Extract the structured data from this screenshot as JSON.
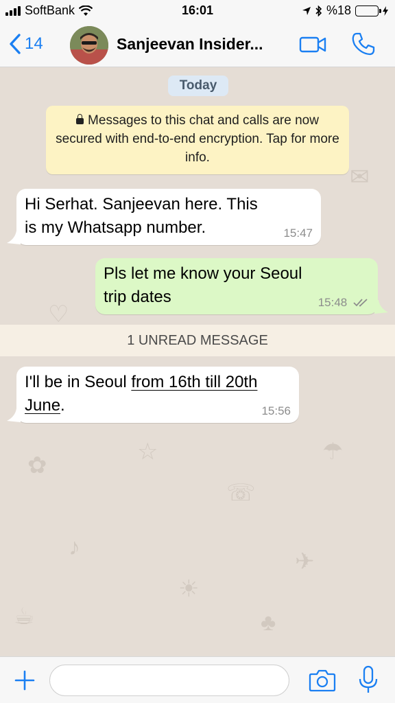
{
  "status_bar": {
    "carrier": "SoftBank",
    "time": "16:01",
    "battery_label": "%18",
    "battery_level": 0.18
  },
  "header": {
    "back_count": "14",
    "contact_name": "Sanjeevan Insider...",
    "icons": [
      "chevron-left-icon",
      "video-call-icon",
      "phone-icon"
    ]
  },
  "chat": {
    "date_label": "Today",
    "encryption_notice": "Messages to this chat and calls are now secured with end-to-end encryption. Tap for more info.",
    "messages": [
      {
        "direction": "incoming",
        "text": "Hi Serhat. Sanjeevan here. This is my Whatsapp number.",
        "time": "15:47"
      },
      {
        "direction": "outgoing",
        "text": "Pls let me know your Seoul trip dates",
        "time": "15:48",
        "status": "delivered"
      },
      {
        "direction": "incoming",
        "text_before": "I'll be in Seoul ",
        "text_link": "from 16th till 20th June",
        "text_after": ".",
        "time": "15:56"
      }
    ],
    "unread_label": "1 UNREAD MESSAGE"
  },
  "input_bar": {
    "placeholder": "",
    "icons": [
      "plus-icon",
      "camera-icon",
      "microphone-icon"
    ]
  },
  "colors": {
    "accent": "#1a7ff2",
    "outgoing_bubble": "#dcf8c6",
    "incoming_bubble": "#ffffff",
    "chat_background": "#e5ddd5",
    "notice_background": "#fdf3c4",
    "battery_fill": "#f4c20d"
  }
}
